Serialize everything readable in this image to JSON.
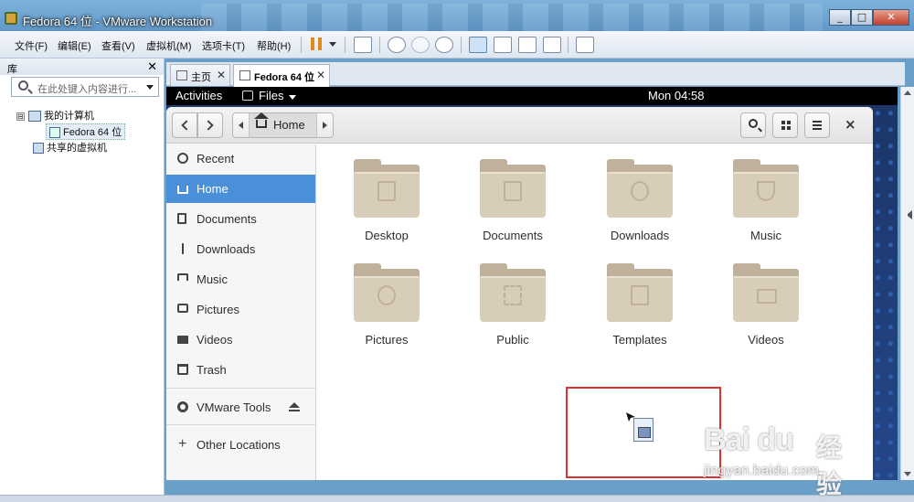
{
  "window": {
    "title": "Fedora 64 位 - VMware Workstation",
    "min": "_",
    "max": "□",
    "close": "✕"
  },
  "menu": [
    "文件(F)",
    "编辑(E)",
    "查看(V)",
    "虚拟机(M)",
    "选项卡(T)",
    "帮助(H)"
  ],
  "library": {
    "title": "库",
    "close": "✕",
    "search_placeholder": "在此处键入内容进行...",
    "tree": {
      "my_computer": "我的计算机",
      "vm": "Fedora 64 位",
      "shared": "共享的虚拟机",
      "collapse": "⊟"
    }
  },
  "tabs": [
    {
      "label": "主页",
      "close": "✕"
    },
    {
      "label": "Fedora 64 位",
      "close": "✕"
    }
  ],
  "gnome": {
    "activities": "Activities",
    "files_menu": "Files",
    "clock": "Mon 04:58"
  },
  "nautilus": {
    "path": "Home",
    "close": "×",
    "sidebar": {
      "recent": "Recent",
      "home": "Home",
      "documents": "Documents",
      "downloads": "Downloads",
      "music": "Music",
      "pictures": "Pictures",
      "videos": "Videos",
      "trash": "Trash",
      "vmware_tools": "VMware Tools",
      "other_locations": "Other Locations",
      "plus": "+"
    },
    "folders": [
      "Desktop",
      "Documents",
      "Downloads",
      "Music",
      "Pictures",
      "Public",
      "Templates",
      "Videos"
    ]
  },
  "watermark": {
    "logo": "Bai du",
    "cn": "经验",
    "url": "jingyan.baidu.com"
  },
  "colors": {
    "selection": "#4a90d9",
    "folder": "#d8cdb8",
    "highlight_box": "#e03030"
  }
}
